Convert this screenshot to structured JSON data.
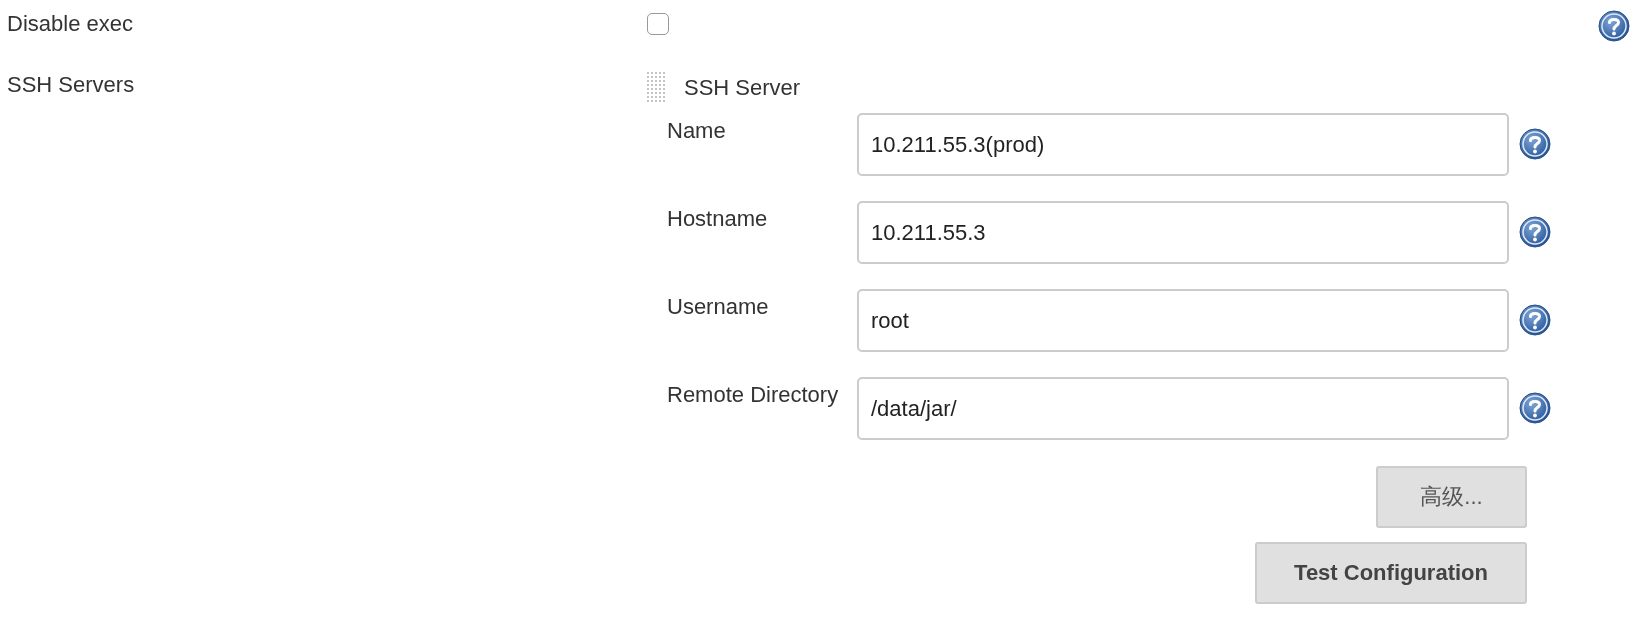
{
  "disable_exec": {
    "label": "Disable exec",
    "checked": false
  },
  "ssh_servers": {
    "label": "SSH Servers",
    "server": {
      "title": "SSH Server",
      "fields": [
        {
          "label": "Name",
          "value": "10.211.55.3(prod)"
        },
        {
          "label": "Hostname",
          "value": "10.211.55.3"
        },
        {
          "label": "Username",
          "value": "root"
        },
        {
          "label": "Remote Directory",
          "value": "/data/jar/"
        }
      ],
      "buttons": [
        {
          "label": "高级...",
          "kind": "advanced"
        },
        {
          "label": "Test Configuration",
          "kind": "test"
        }
      ]
    }
  }
}
